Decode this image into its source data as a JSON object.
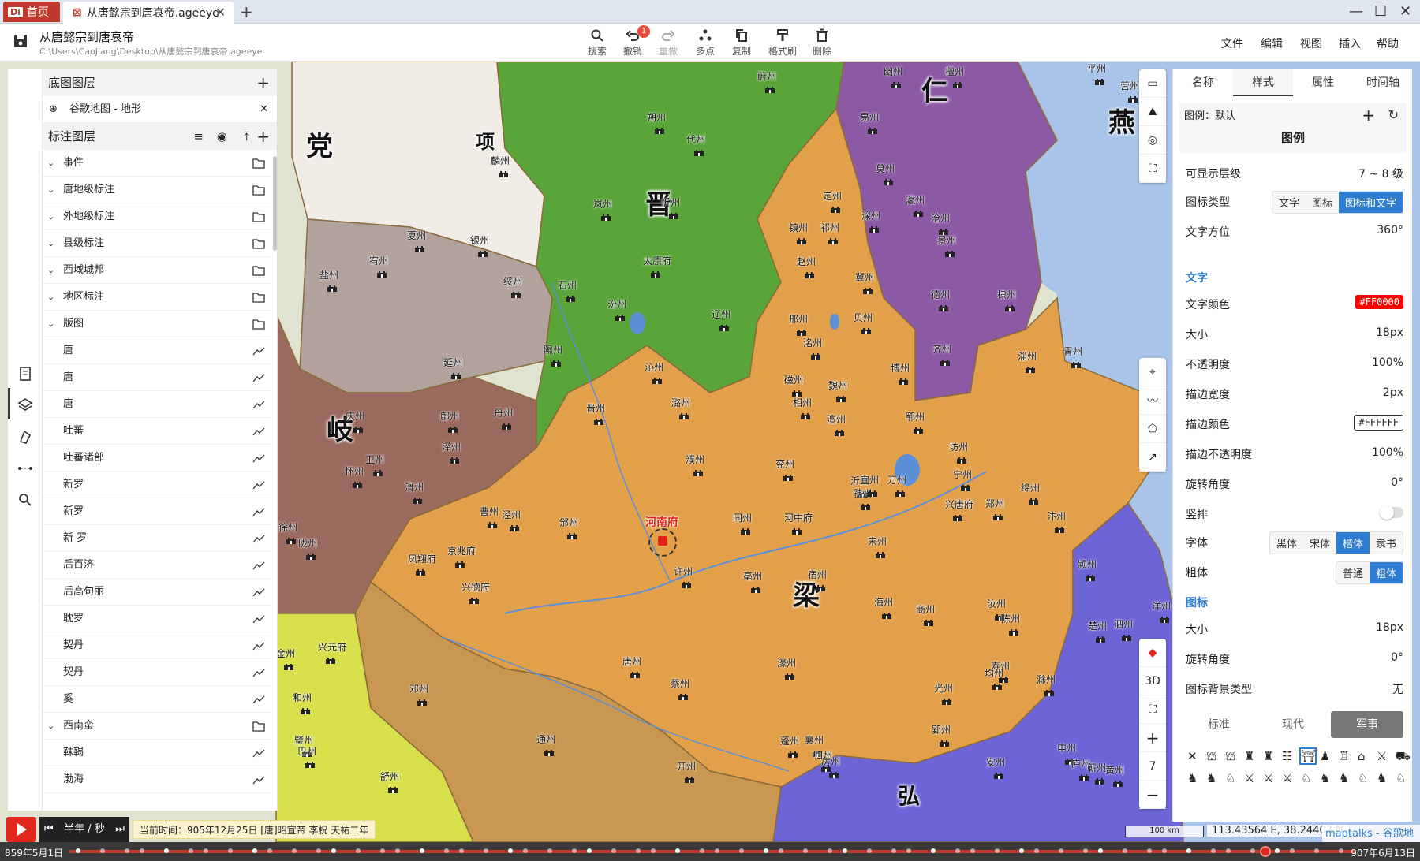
{
  "titlebar": {
    "home_tab": "首页",
    "home_logo": "Di",
    "doc_tab": "从唐懿宗到唐哀帝.ageeye"
  },
  "toolbar": {
    "title": "从唐懿宗到唐哀帝",
    "path": "C:\\Users\\CaoJiang\\Desktop\\从唐懿宗到唐哀帝.ageeye",
    "tools": {
      "search": "搜索",
      "undo": "撤销",
      "undo_badge": "1",
      "redo": "重做",
      "multipoint": "多点",
      "copy": "复制",
      "format_painter": "格式刷",
      "delete": "删除"
    },
    "menu": {
      "file": "文件",
      "edit": "编辑",
      "view": "视图",
      "insert": "插入",
      "help": "帮助"
    }
  },
  "layers": {
    "basemap_title": "底图图层",
    "basemap_item": "谷歌地图 - 地形",
    "annotation_title": "标注图层",
    "groups": [
      {
        "label": "事件"
      },
      {
        "label": "唐地级标注"
      },
      {
        "label": "外地级标注"
      },
      {
        "label": "县级标注"
      },
      {
        "label": "西域城邦"
      },
      {
        "label": "地区标注"
      },
      {
        "label": "版图"
      }
    ],
    "children": [
      {
        "label": "唐"
      },
      {
        "label": "唐"
      },
      {
        "label": "唐"
      },
      {
        "label": "吐蕃"
      },
      {
        "label": "吐蕃诸部"
      },
      {
        "label": "新罗"
      },
      {
        "label": "新罗"
      },
      {
        "label": "新 罗"
      },
      {
        "label": "后百济"
      },
      {
        "label": "后高句丽"
      },
      {
        "label": "耽罗"
      },
      {
        "label": "契丹"
      },
      {
        "label": "契丹"
      },
      {
        "label": "奚"
      }
    ],
    "group2": {
      "label": "西南蛮"
    },
    "children2": [
      {
        "label": "靺鞨"
      },
      {
        "label": "渤海"
      }
    ]
  },
  "map": {
    "regions": [
      {
        "label": "党",
        "color": "#f1ece6"
      },
      {
        "label": "项"
      },
      {
        "label": "晋",
        "color": "#5aa53a"
      },
      {
        "label": "岐",
        "color": "#9b6a5e"
      },
      {
        "label": "梁",
        "color": "#e2a04a"
      },
      {
        "label": "仁"
      },
      {
        "label": "燕"
      },
      {
        "label": "弘"
      }
    ],
    "capital": "河南府",
    "places": [
      "朔州",
      "代州",
      "蔚州",
      "易州",
      "幽州",
      "檀州",
      "平州",
      "营州",
      "麟州",
      "岚州",
      "忻州",
      "定州",
      "莫州",
      "瀛州",
      "夏州",
      "宥州",
      "银州",
      "绥州",
      "石州",
      "太原府",
      "镇州",
      "祁州",
      "深州",
      "沧州",
      "景州",
      "盐州",
      "赵州",
      "冀州",
      "德州",
      "棣州",
      "汾州",
      "辽州",
      "邢州",
      "洺州",
      "贝州",
      "隰州",
      "沁州",
      "磁州",
      "魏州",
      "博州",
      "齐州",
      "淄州",
      "青州",
      "延州",
      "庆州",
      "鄜州",
      "丹州",
      "晋州",
      "潞州",
      "相州",
      "澶州",
      "郓州",
      "坊州",
      "泽州",
      "卫州",
      "濮州",
      "兖州",
      "沂州",
      "宁州",
      "绛州",
      "怀州",
      "滑州",
      "曹州",
      "泾州",
      "邠州",
      "同州",
      "河中府",
      "虢州",
      "兴唐府",
      "郑州",
      "汴州",
      "宋州",
      "徐州",
      "陇州",
      "凤翔府",
      "京兆府",
      "兴德府",
      "许州",
      "亳州",
      "宿州",
      "海州",
      "商州",
      "汝州",
      "陈州",
      "颍州",
      "泗州",
      "楚州",
      "洋州",
      "兴元府",
      "金州",
      "邓州",
      "唐州",
      "蔡州",
      "濠州",
      "寿州",
      "均州",
      "光州",
      "滁州",
      "和州",
      "璧州",
      "房州",
      "襄州",
      "申州",
      "庐州",
      "巴州",
      "通州",
      "开州",
      "蓬州",
      "归州",
      "郢州",
      "安州",
      "黄州",
      "蕲州",
      "舒州",
      "宣州",
      "万州"
    ],
    "place_positions": [],
    "zoom_level": "7",
    "scale": "100 km",
    "coord": "113.43564 E, 38.24403 N",
    "attribution": "maptalks - 谷歌地图"
  },
  "right_panel": {
    "tabs": [
      "名称",
      "样式",
      "属性",
      "时间轴"
    ],
    "legend_label": "图例：默认",
    "legend_title": "图例",
    "visible_levels_label": "可显示层级",
    "visible_levels": "7 ~ 8 级",
    "icon_type_label": "图标类型",
    "icon_type_options": [
      "文字",
      "图标",
      "图标和文字"
    ],
    "text_orient_label": "文字方位",
    "text_orient": "360°",
    "text_section": "文字",
    "text_color_label": "文字颜色",
    "text_color": "#FF0000",
    "size_label": "大小",
    "text_size": "18px",
    "opacity_label": "不透明度",
    "opacity": "100%",
    "stroke_width_label": "描边宽度",
    "stroke_width": "2px",
    "stroke_color_label": "描边颜色",
    "stroke_color": "#FFFFFF",
    "stroke_opacity_label": "描边不透明度",
    "stroke_opacity": "100%",
    "rotation_label": "旋转角度",
    "rotation": "0°",
    "vertical_label": "竖排",
    "font_label": "字体",
    "font_options": [
      "黑体",
      "宋体",
      "楷体",
      "隶书"
    ],
    "bold_label": "粗体",
    "bold_options": [
      "普通",
      "粗体"
    ],
    "icon_section": "图标",
    "icon_size_label": "大小",
    "icon_size": "18px",
    "icon_rotation_label": "旋转角度",
    "icon_rotation": "0°",
    "icon_bg_label": "图标背景类型",
    "icon_bg": "无",
    "categories": [
      "标准",
      "现代",
      "军事"
    ]
  },
  "playbar": {
    "speed": "半年 / 秒",
    "current_time": "当前时间：905年12月25日 [唐]昭宣帝 李柷 天祐二年",
    "start_date": "859年5月1日",
    "end_date": "907年6月13日",
    "progress": 0.93
  },
  "colors": {
    "accent": "#2d7dd2",
    "play": "#e0281c",
    "liang": "#e2a04a",
    "jin": "#5aa53a",
    "qi": "#9b6a5e",
    "yan": "#8c5aa5",
    "sea": "#a9c4e8",
    "hong": "#6d65d6",
    "southwest": "#d7e04a"
  }
}
